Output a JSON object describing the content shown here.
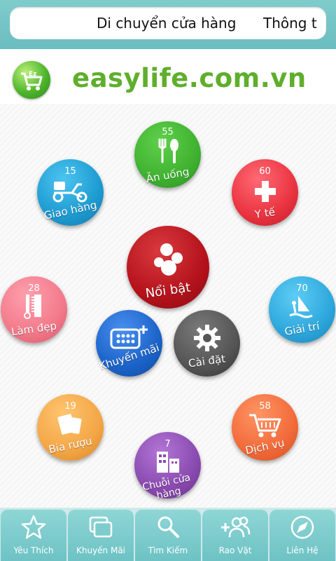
{
  "topbar": {
    "marquee_text_1": "Di chuyển cửa hàng",
    "marquee_text_2": "Thông t"
  },
  "header": {
    "site_title": "easylife.com.vn"
  },
  "categories": {
    "an_uong": {
      "label": "Ăn uống",
      "count": "55",
      "color": "#3fb231"
    },
    "y_te": {
      "label": "Y tế",
      "count": "60",
      "color": "#ea3340"
    },
    "giao_hang": {
      "label": "Giao hàng",
      "count": "15",
      "color": "#1d9bd0"
    },
    "noi_bat": {
      "label": "Nổi bật",
      "color": "#b5121b"
    },
    "lam_dep": {
      "label": "Làm đẹp",
      "count": "28",
      "color": "#f27a8a"
    },
    "giai_tri": {
      "label": "Giải trí",
      "count": "70",
      "color": "#2da7dc"
    },
    "khuyen_mai": {
      "label": "Khuyến mãi",
      "color": "#1b63c8"
    },
    "cai_dat": {
      "label": "Cài đặt",
      "color": "#555555"
    },
    "bia_ruou": {
      "label": "Bia rượu",
      "count": "19",
      "color": "#f3a646"
    },
    "dich_vu": {
      "label": "Dịch vụ",
      "count": "58",
      "color": "#f26a3a"
    },
    "chuoi_cua_hang": {
      "label": "Chuỗi cửa hàng",
      "count": "7",
      "color": "#8a4ab0"
    }
  },
  "bottom_nav": {
    "yeu_thich": "Yêu Thích",
    "khuyen_mai": "Khuyến Mãi",
    "tim_kiem": "Tìm Kiếm",
    "rao_vat": "Rao Vặt",
    "lien_he": "Liên Hệ"
  }
}
